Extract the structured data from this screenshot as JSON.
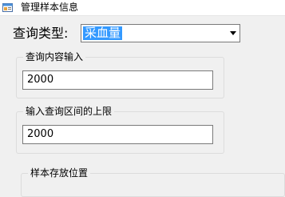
{
  "window": {
    "title": "管理样本信息",
    "icon": "app-window-icon"
  },
  "query_type": {
    "label": "查询类型:",
    "selected": "采血量"
  },
  "content_group": {
    "caption": "查询内容输入",
    "value": "2000"
  },
  "upper_group": {
    "caption": "输入查询区间的上限",
    "value": "2000"
  },
  "storage_group": {
    "caption": "样本存放位置"
  },
  "colors": {
    "selection": "#3399ff",
    "background": "#f0f0f0"
  }
}
